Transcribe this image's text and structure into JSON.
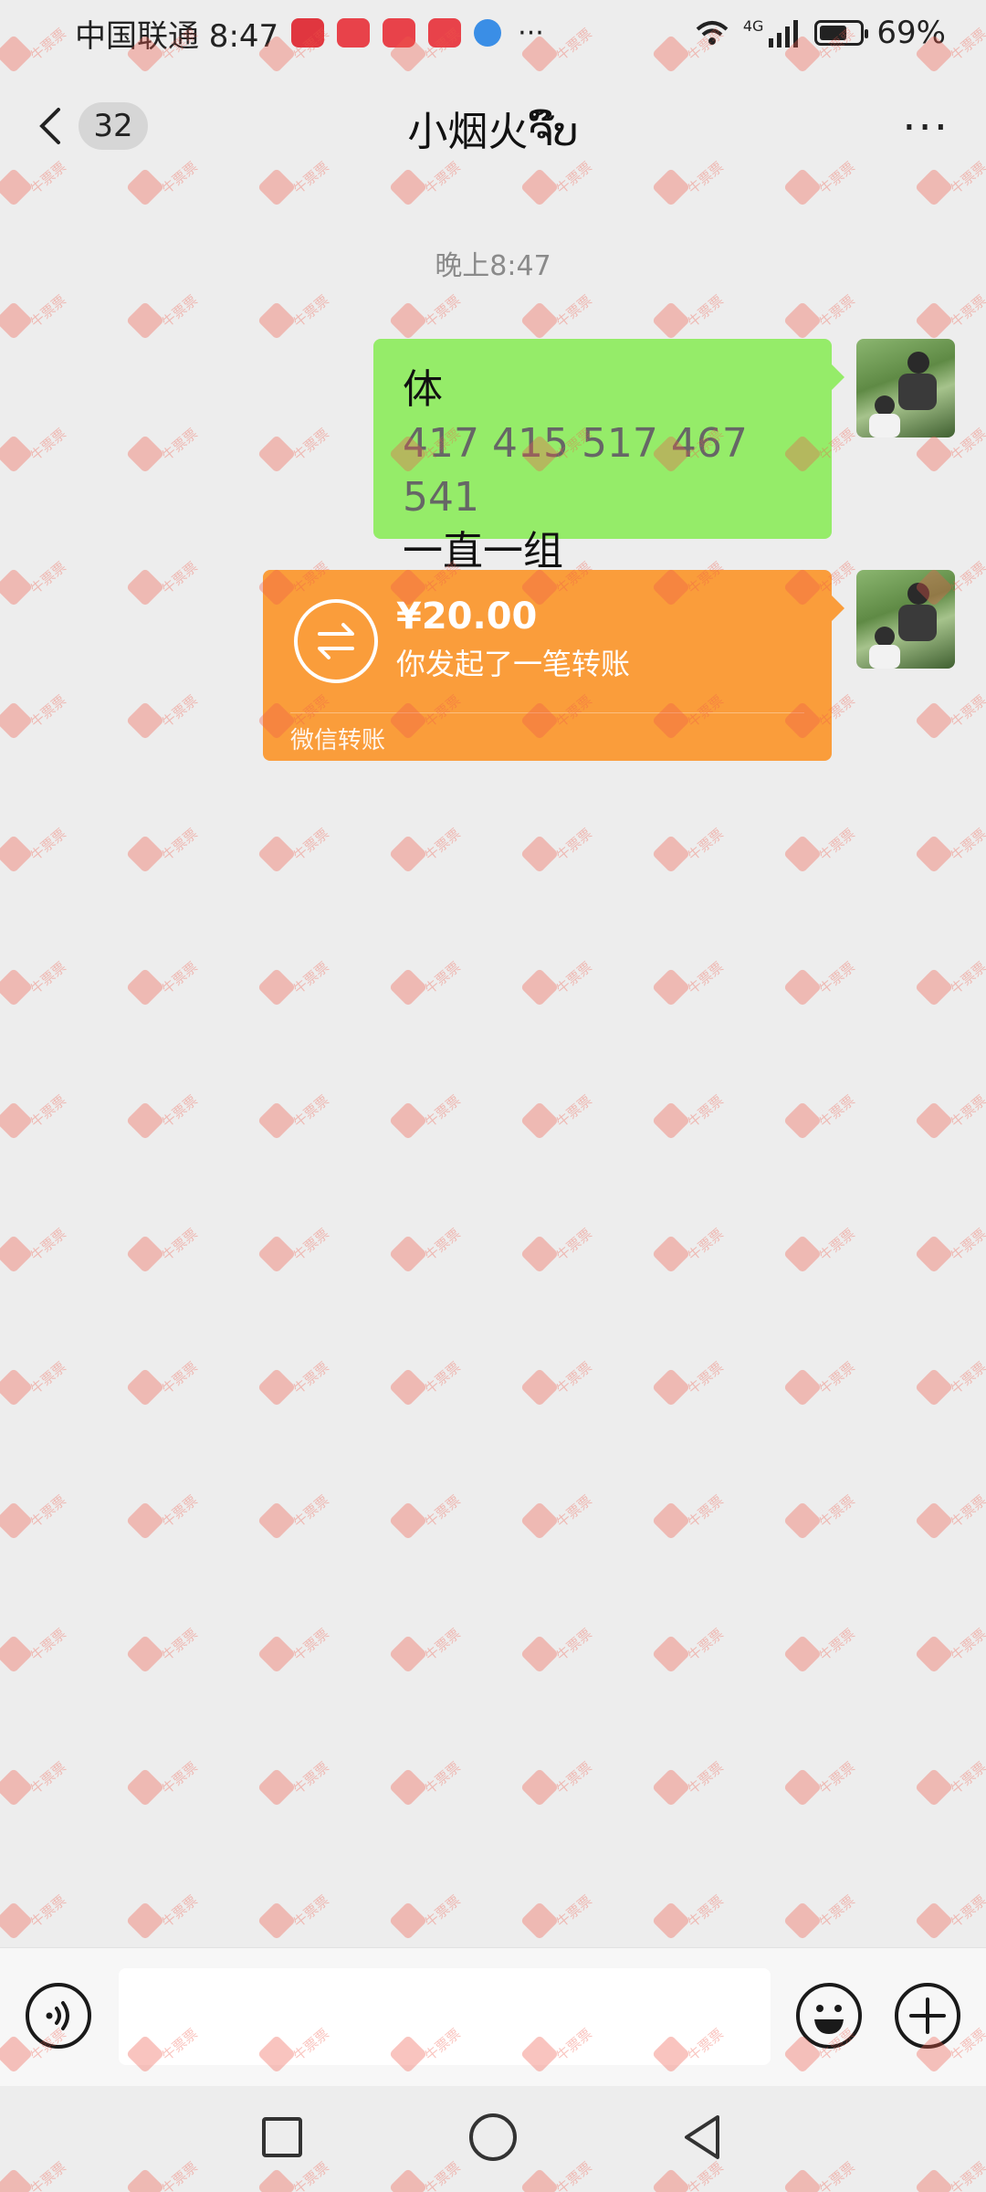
{
  "status_bar": {
    "carrier_time": "中国联通 8:47",
    "more": "···",
    "network": "4G",
    "battery_text": "69%",
    "battery_level": 0.69
  },
  "header": {
    "unread_count": "32",
    "title": "小烟火ຈົ໊ບ",
    "more": "···"
  },
  "chat": {
    "timestamp": "晚上8:47",
    "messages": [
      {
        "type": "text",
        "lines": [
          "体",
          "417 415 517 467 541",
          "一直一组"
        ]
      },
      {
        "type": "transfer",
        "amount": "¥20.00",
        "description": "你发起了一笔转账",
        "footer": "微信转账"
      }
    ]
  },
  "input_bar": {
    "placeholder": ""
  },
  "watermark": {
    "text": "牛票票",
    "color": "#f05a4a"
  },
  "colors": {
    "chat_bg": "#ededed",
    "sent_bubble": "#95ec69",
    "transfer_card": "#fa9d3b"
  }
}
